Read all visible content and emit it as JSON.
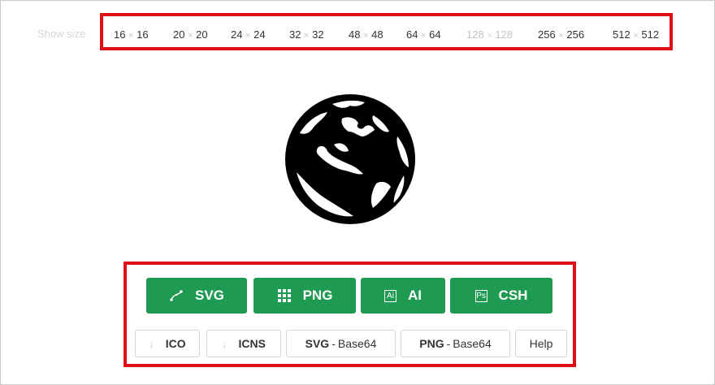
{
  "show_size_label": "Show size",
  "sizes": [
    {
      "w": "16",
      "h": "16"
    },
    {
      "w": "20",
      "h": "20"
    },
    {
      "w": "24",
      "h": "24"
    },
    {
      "w": "32",
      "h": "32"
    },
    {
      "w": "48",
      "h": "48"
    },
    {
      "w": "64",
      "h": "64"
    },
    {
      "w": "128",
      "h": "128"
    },
    {
      "w": "256",
      "h": "256"
    },
    {
      "w": "512",
      "h": "512"
    }
  ],
  "size_separator": "×",
  "downloads": {
    "svg": {
      "label": "SVG",
      "icon": "vector-path-icon"
    },
    "png": {
      "label": "PNG",
      "icon": "grid-icon"
    },
    "ai": {
      "label": "AI",
      "icon": "illustrator-icon",
      "glyph": "Ai"
    },
    "csh": {
      "label": "CSH",
      "icon": "photoshop-icon",
      "glyph": "Ps"
    }
  },
  "secondary": {
    "ico": {
      "label": "ICO",
      "icon": "download-arrow-icon"
    },
    "icns": {
      "label": "ICNS",
      "icon": "download-arrow-icon"
    },
    "svg_base64": {
      "format": "SVG",
      "sep": "-",
      "encoding": "Base64"
    },
    "png_base64": {
      "format": "PNG",
      "sep": "-",
      "encoding": "Base64"
    },
    "help": {
      "label": "Help"
    }
  },
  "colors": {
    "accent_green": "#1f9a52",
    "highlight_red": "#e01018"
  }
}
